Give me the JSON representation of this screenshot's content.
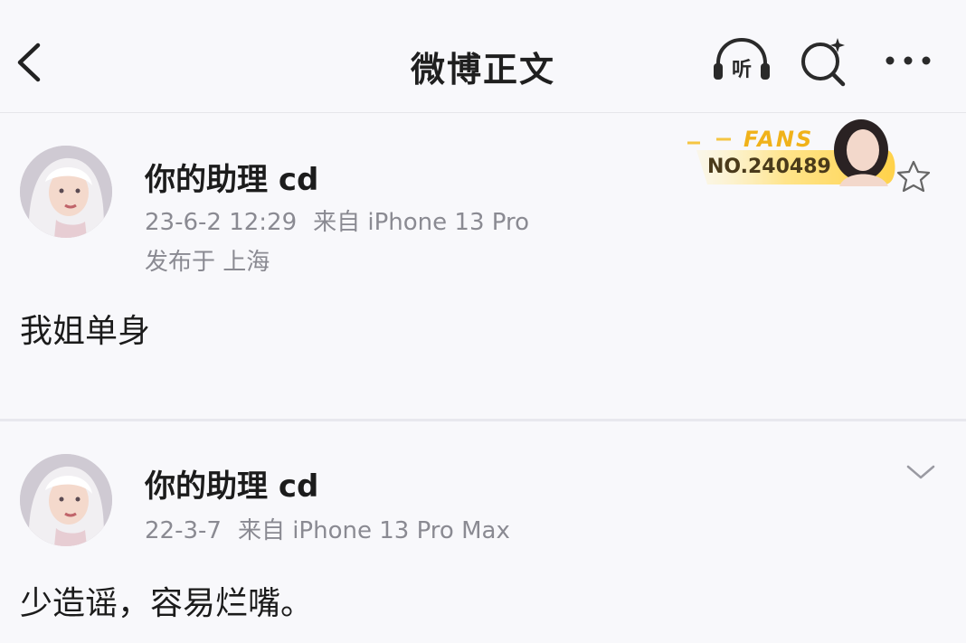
{
  "header": {
    "title": "微博正文",
    "listen_label": "听"
  },
  "posts": [
    {
      "username": "你的助理 cd",
      "date": "23-6-2 12:29",
      "source": "来自 iPhone 13 Pro",
      "location": "发布于 上海",
      "content": "我姐单身",
      "badge": {
        "word": "FANS",
        "number": "NO.240489"
      }
    },
    {
      "username": "你的助理 cd",
      "date": "22-3-7",
      "source": "来自 iPhone 13 Pro Max",
      "content": "少造谣，容易烂嘴。"
    }
  ],
  "colors": {
    "background": "#f8f8fb",
    "text_primary": "#1c1c1c",
    "text_meta": "#8a8a92",
    "badge_gold": "#f0b21a"
  },
  "icons": [
    "back-arrow-icon",
    "headphones-icon",
    "search-icon",
    "more-icon",
    "star-icon",
    "chevron-down-icon"
  ]
}
